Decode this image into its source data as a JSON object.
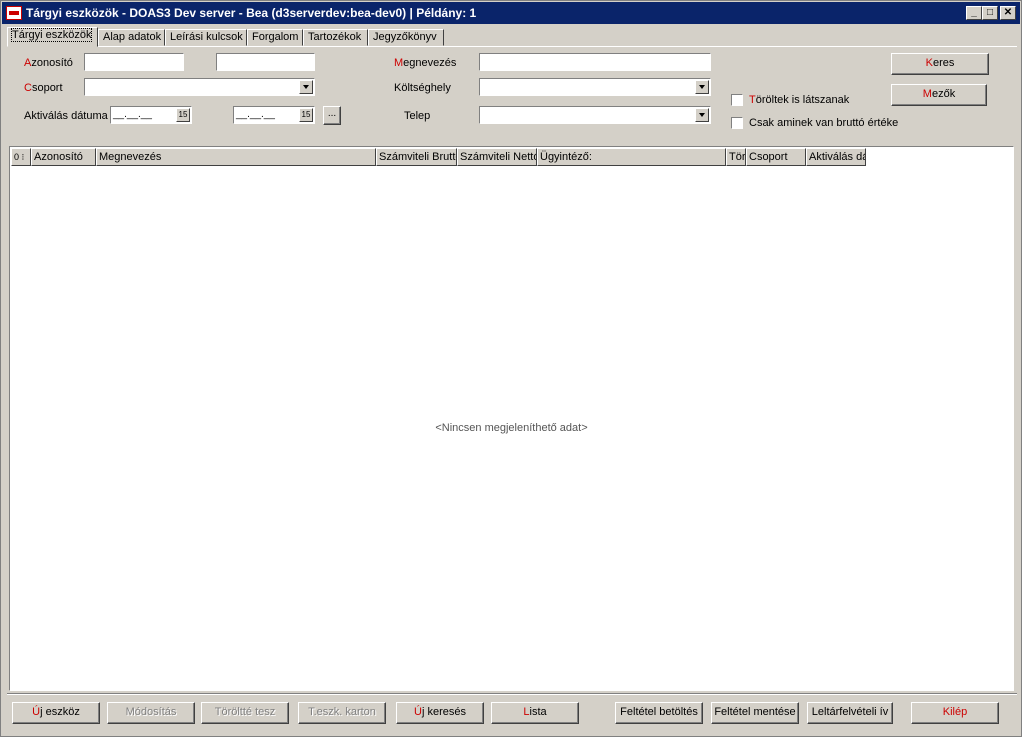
{
  "window": {
    "title": "Tárgyi eszközök - DOAS3 Dev server - Bea (d3serverdev:bea-dev0) | Példány: 1",
    "minimize": "_",
    "maximize": "□",
    "close": "✕"
  },
  "tabs": [
    {
      "label": "Tárgyi eszközök"
    },
    {
      "label": "Alap adatok"
    },
    {
      "label": "Leírási kulcsok"
    },
    {
      "label": "Forgalom"
    },
    {
      "label": "Tartozékok"
    },
    {
      "label": "Jegyzőkönyv"
    }
  ],
  "filters": {
    "azonosito": {
      "accel": "A",
      "rest": "zonosító",
      "value_from": "",
      "value_to": ""
    },
    "csoport": {
      "accel": "C",
      "rest": "soport",
      "value": ""
    },
    "aktivalas": {
      "label": "Aktiválás dátuma",
      "from": "__.__.__",
      "to": "__.__.__",
      "cal_icon": "15",
      "more": "..."
    },
    "megnevezes": {
      "accel": "M",
      "rest": "egnevezés",
      "value": ""
    },
    "koltseghely": {
      "label": "Költséghely",
      "value": ""
    },
    "telep": {
      "label": "Telep",
      "value": ""
    },
    "toroltek": {
      "accel": "T",
      "rest": "öröltek is látszanak",
      "checked": false
    },
    "brutto": {
      "label": "Csak aminek van bruttó értéke",
      "checked": false
    }
  },
  "side_buttons": {
    "keres": {
      "accel": "K",
      "rest": "eres"
    },
    "mezok": {
      "accel": "M",
      "rest": "ezők"
    }
  },
  "grid": {
    "columns": [
      {
        "label": "0 ⁝"
      },
      {
        "label": "Azonosító"
      },
      {
        "label": "Megnevezés"
      },
      {
        "label": "Számviteli Bruttó"
      },
      {
        "label": "Számviteli Nettó"
      },
      {
        "label": "Ügyintéző:"
      },
      {
        "label": "Tör"
      },
      {
        "label": "Csoport"
      },
      {
        "label": "Aktiválás dá"
      }
    ],
    "empty_message": "<Nincsen megjeleníthető adat>"
  },
  "bottom_buttons": [
    {
      "accel": "Ú",
      "rest": "j eszköz",
      "enabled": true
    },
    {
      "accel": "",
      "rest": "Módosítás",
      "enabled": false
    },
    {
      "accel": "",
      "rest": "Töröltté tesz",
      "enabled": false
    },
    {
      "accel": "",
      "rest": "T.eszk. karton",
      "enabled": false
    },
    {
      "accel": "Ú",
      "rest": "j keresés",
      "enabled": true
    },
    {
      "accel": "L",
      "rest": "ista",
      "enabled": true
    },
    {
      "accel": "",
      "rest": "Feltétel betöltés",
      "enabled": true
    },
    {
      "accel": "",
      "rest": "Feltétel mentése",
      "enabled": true
    },
    {
      "accel": "",
      "rest": "Leltárfelvételi ív",
      "enabled": true
    },
    {
      "accel": "",
      "rest": "Kilép",
      "enabled": true
    }
  ]
}
